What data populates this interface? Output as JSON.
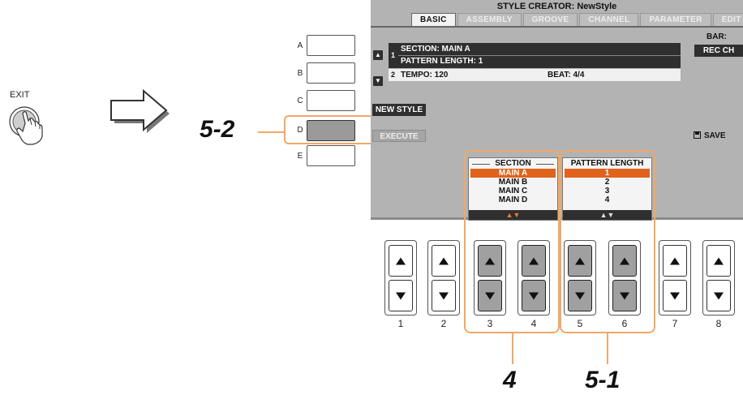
{
  "exit": {
    "label": "EXIT"
  },
  "side_buttons": [
    "A",
    "B",
    "C",
    "D",
    "E"
  ],
  "steps": {
    "step_5_2": "5-2",
    "step_4": "4",
    "step_5_1": "5-1"
  },
  "screen": {
    "title": "STYLE CREATOR: NewStyle",
    "tabs": [
      "BASIC",
      "ASSEMBLY",
      "GROOVE",
      "CHANNEL",
      "PARAMETER",
      "EDIT"
    ],
    "active_tab": "BASIC",
    "bar_label": "BAR:",
    "row1": {
      "num": "1",
      "line1": "SECTION: MAIN A",
      "line2": "PATTERN LENGTH: 1"
    },
    "row2": {
      "num": "2",
      "tempo": "TEMPO: 120",
      "beat": "BEAT: 4/4"
    },
    "buttons": {
      "rec_ch": "REC CH",
      "new_style": "NEW STYLE",
      "execute": "EXECUTE",
      "save": "SAVE"
    },
    "section": {
      "header": "SECTION",
      "items": [
        "MAIN A",
        "MAIN B",
        "MAIN C",
        "MAIN D"
      ],
      "selected": "MAIN A",
      "footer": "▲▼"
    },
    "pattern_length": {
      "header": "PATTERN LENGTH",
      "items": [
        "1",
        "2",
        "3",
        "4"
      ],
      "selected": "1",
      "footer": "▲▼"
    }
  },
  "bottom_buttons": [
    "1",
    "2",
    "3",
    "4",
    "5",
    "6",
    "7",
    "8"
  ],
  "colors": {
    "highlight": "#e0621b",
    "callout": "#f0a868",
    "lcd": "#b3b3b3"
  }
}
